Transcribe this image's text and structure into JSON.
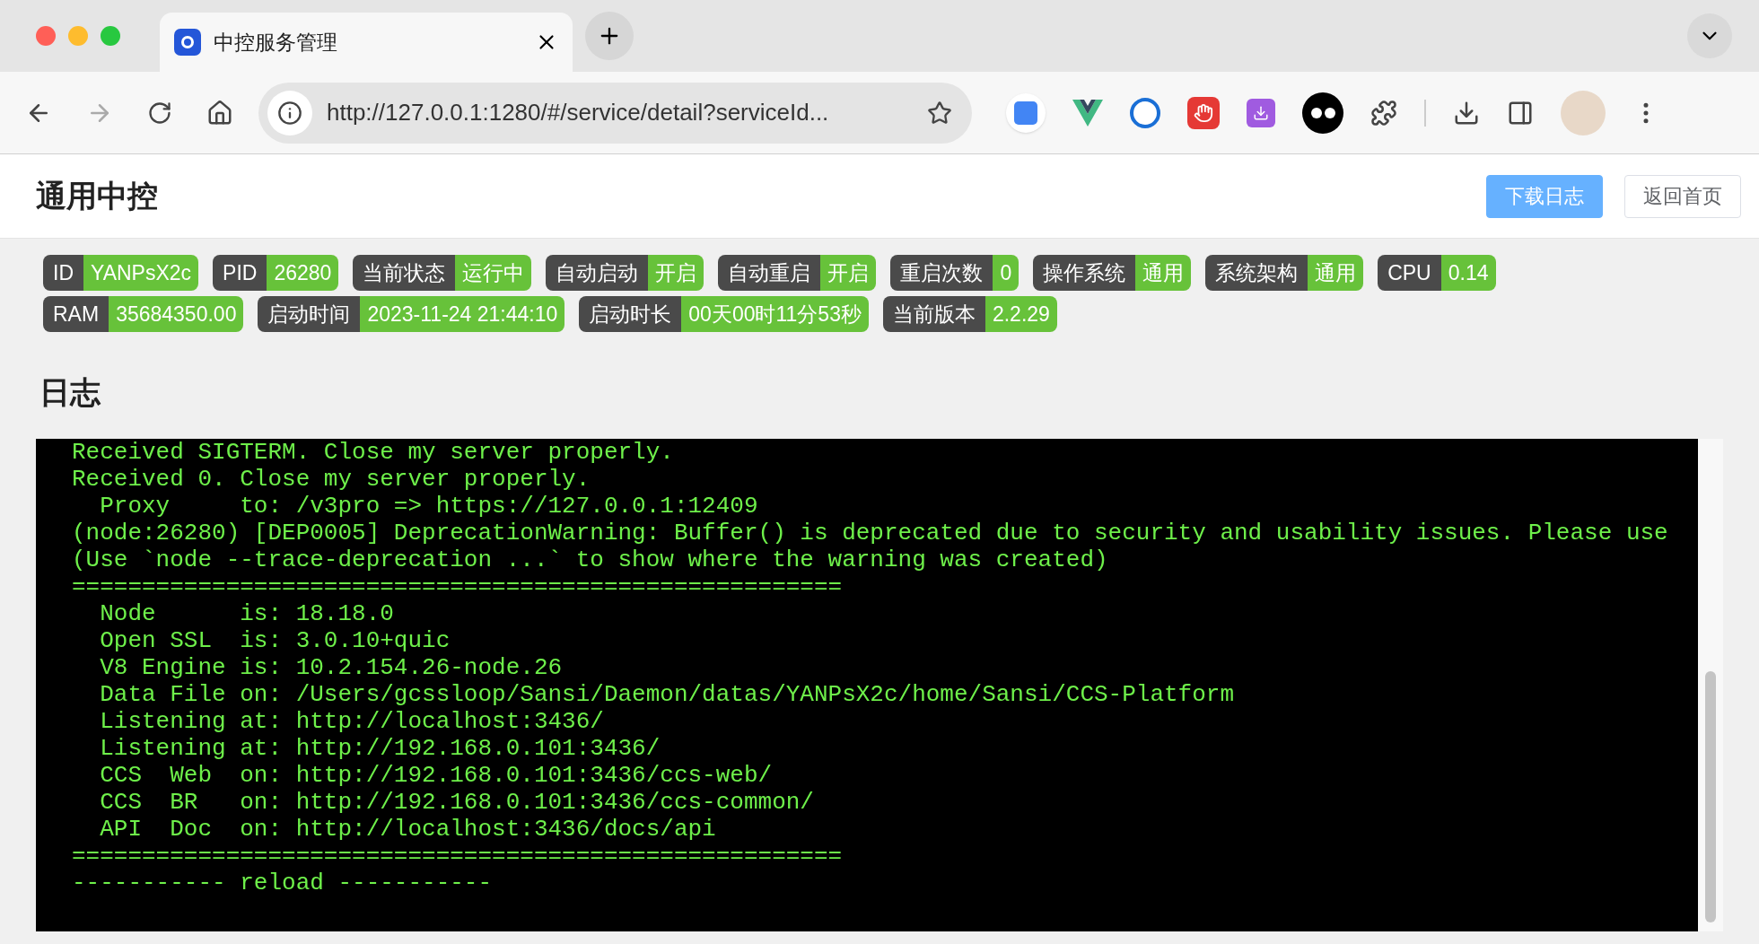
{
  "browser": {
    "tab_title": "中控服务管理",
    "url": "http://127.0.0.1:1280/#/service/detail?serviceId..."
  },
  "header": {
    "title": "通用中控",
    "buttons": [
      {
        "label": "下载日志",
        "kind": "primary"
      },
      {
        "label": "返回首页",
        "kind": "plain"
      }
    ]
  },
  "badges": [
    {
      "label": "ID",
      "value": "YANPsX2c"
    },
    {
      "label": "PID",
      "value": "26280"
    },
    {
      "label": "当前状态",
      "value": "运行中"
    },
    {
      "label": "自动启动",
      "value": "开启"
    },
    {
      "label": "自动重启",
      "value": "开启"
    },
    {
      "label": "重启次数",
      "value": "0"
    },
    {
      "label": "操作系统",
      "value": "通用"
    },
    {
      "label": "系统架构",
      "value": "通用"
    },
    {
      "label": "CPU",
      "value": "0.14"
    },
    {
      "label": "RAM",
      "value": "35684350.00"
    },
    {
      "label": "启动时间",
      "value": "2023-11-24 21:44:10"
    },
    {
      "label": "启动时长",
      "value": "00天00时11分53秒"
    },
    {
      "label": "当前版本",
      "value": "2.2.29"
    }
  ],
  "log": {
    "title": "日志",
    "lines": [
      "Received SIGTERM. Close my server properly.",
      "Received 0. Close my server properly.",
      "  Proxy     to: /v3pro => https://127.0.0.1:12409",
      "(node:26280) [DEP0005] DeprecationWarning: Buffer() is deprecated due to security and usability issues. Please use",
      "(Use `node --trace-deprecation ...` to show where the warning was created)",
      "=======================================================",
      "  Node      is: 18.18.0",
      "  Open SSL  is: 3.0.10+quic",
      "  V8 Engine is: 10.2.154.26-node.26",
      "  Data File on: /Users/gcssloop/Sansi/Daemon/datas/YANPsX2c/home/Sansi/CCS-Platform",
      "  Listening at: http://localhost:3436/",
      "  Listening at: http://192.168.0.101:3436/",
      "  CCS  Web  on: http://192.168.0.101:3436/ccs-web/",
      "  CCS  BR   on: http://192.168.0.101:3436/ccs-common/",
      "  API  Doc  on: http://localhost:3436/docs/api",
      "=======================================================",
      "----------- reload -----------"
    ]
  }
}
